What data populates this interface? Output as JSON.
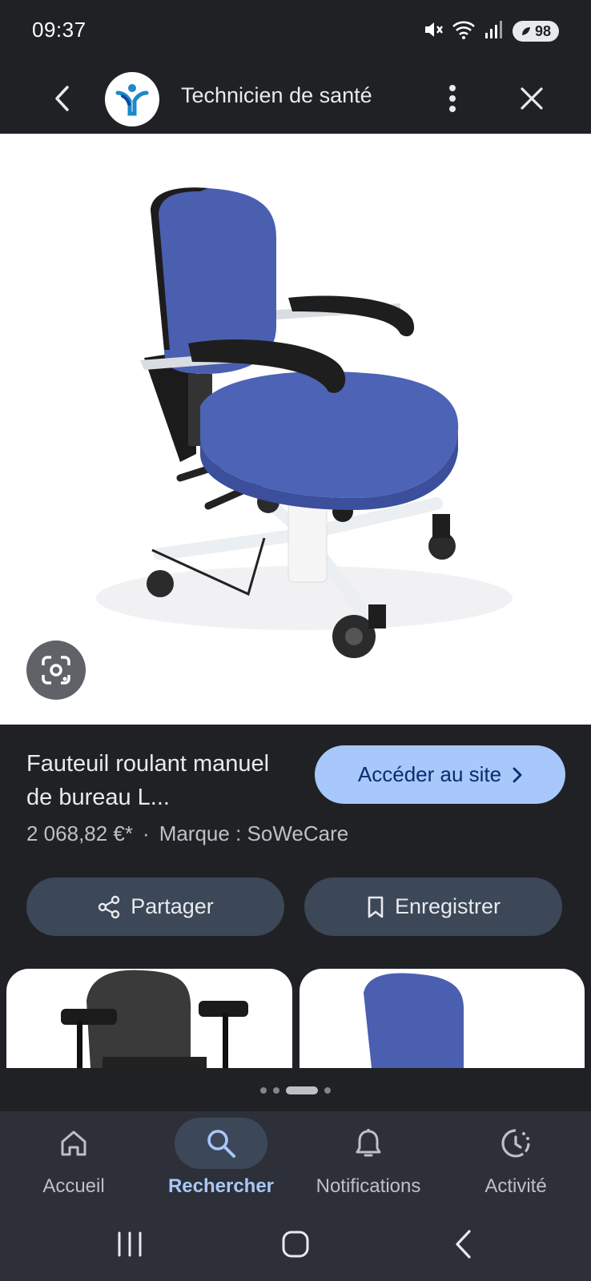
{
  "status_bar": {
    "time": "09:37",
    "battery": "98",
    "icons": [
      "mute-icon",
      "wifi-icon",
      "signal-icon",
      "battery-icon"
    ]
  },
  "app_bar": {
    "title": "Technicien de santé"
  },
  "product": {
    "title": "Fauteuil roulant manuel de bureau L...",
    "visit_label": "Accéder au site",
    "price": "2 068,82 €*",
    "separator": "·",
    "brand": "Marque : SoWeCare"
  },
  "actions": {
    "share_label": "Partager",
    "save_label": "Enregistrer"
  },
  "carousel": {
    "page_count": 4,
    "active_index": 2
  },
  "bottom_nav": {
    "items": [
      {
        "label": "Accueil",
        "icon": "home-icon"
      },
      {
        "label": "Rechercher",
        "icon": "search-icon"
      },
      {
        "label": "Notifications",
        "icon": "bell-icon"
      },
      {
        "label": "Activité",
        "icon": "activity-icon"
      }
    ],
    "active": "Rechercher"
  },
  "colors": {
    "background": "#202124",
    "accent": "#a8c7fa",
    "button_dark": "#3c4758",
    "nav_background": "#2d3038"
  }
}
